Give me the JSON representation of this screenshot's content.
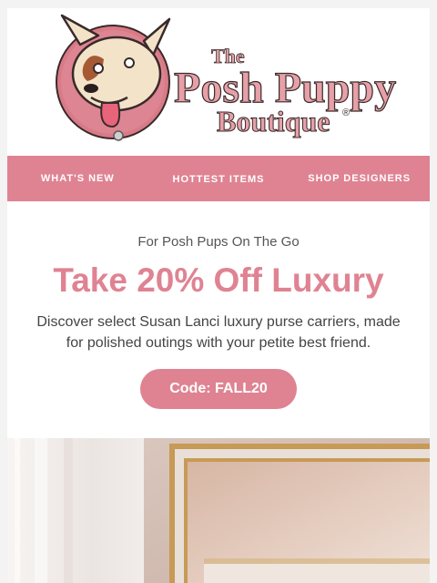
{
  "brand": {
    "line1": "The",
    "line2": "Posh Puppy",
    "line3": "Boutique",
    "registered": "®"
  },
  "nav": {
    "items": [
      {
        "label": "WHAT'S NEW"
      },
      {
        "label": "HOTTEST ITEMS"
      },
      {
        "label": "SHOP DESIGNERS"
      }
    ]
  },
  "promo": {
    "subtitle": "For Posh Pups On The Go",
    "headline": "Take 20% Off Luxury",
    "body": "Discover select Susan Lanci luxury purse carriers, made for polished outings with your petite best friend.",
    "code_button": "Code: FALL20"
  },
  "colors": {
    "accent": "#df8392",
    "logo_text": "#e7a0a8",
    "logo_circle": "#d97a87"
  },
  "hero_image": {
    "icon": "boutique-interior-photo"
  }
}
